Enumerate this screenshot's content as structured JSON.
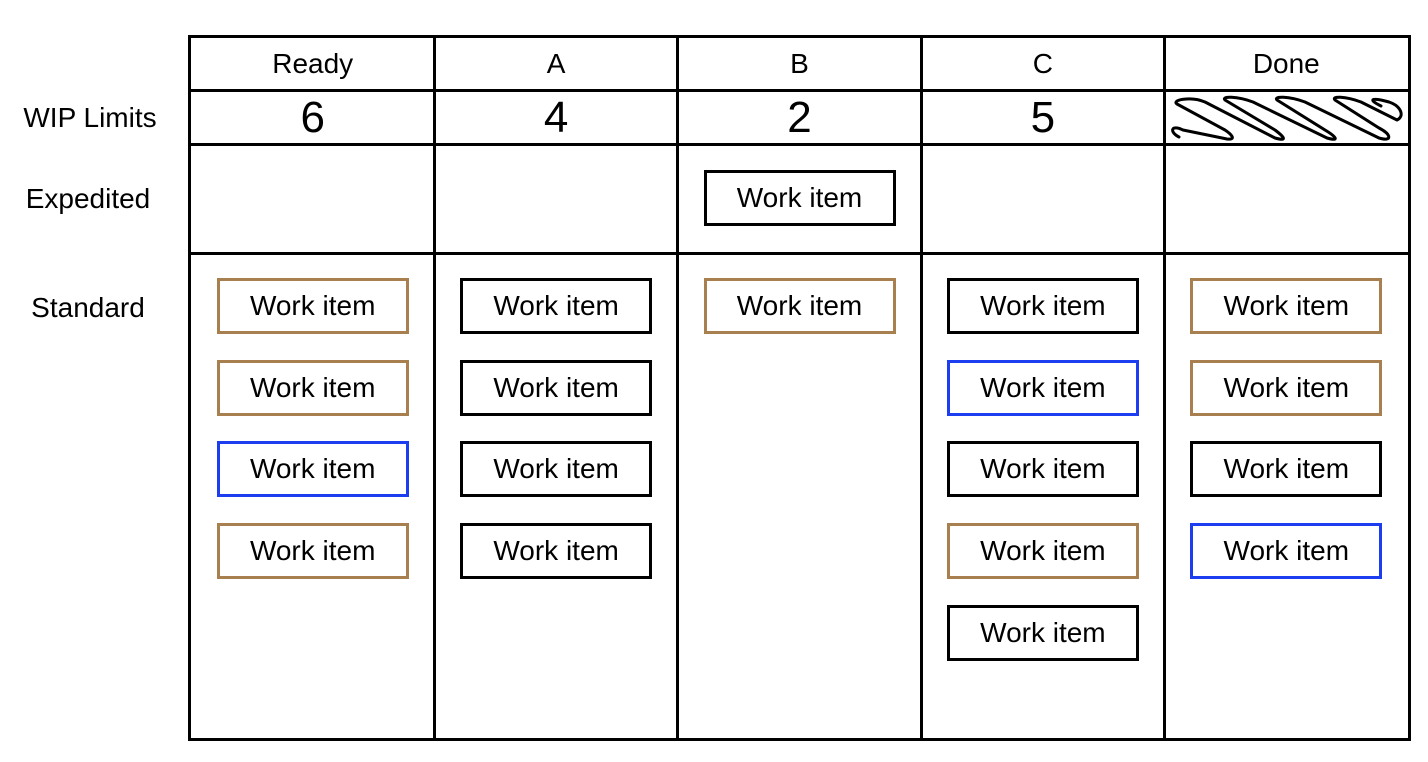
{
  "row_labels": {
    "wip": "WIP Limits",
    "expedited": "Expedited",
    "standard": "Standard"
  },
  "colors": {
    "default": "#000000",
    "brown": "#A8804F",
    "blue": "#1C3DF0"
  },
  "columns": [
    {
      "name": "Ready",
      "wip_limit": "6",
      "expedited": [],
      "standard": [
        {
          "label": "Work item",
          "color": "brown"
        },
        {
          "label": "Work item",
          "color": "brown"
        },
        {
          "label": "Work item",
          "color": "blue"
        },
        {
          "label": "Work item",
          "color": "brown"
        }
      ]
    },
    {
      "name": "A",
      "wip_limit": "4",
      "expedited": [],
      "standard": [
        {
          "label": "Work item",
          "color": "default"
        },
        {
          "label": "Work item",
          "color": "default"
        },
        {
          "label": "Work item",
          "color": "default"
        },
        {
          "label": "Work item",
          "color": "default"
        }
      ]
    },
    {
      "name": "B",
      "wip_limit": "2",
      "expedited": [
        {
          "label": "Work item",
          "color": "default"
        }
      ],
      "standard": [
        {
          "label": "Work item",
          "color": "brown"
        }
      ]
    },
    {
      "name": "C",
      "wip_limit": "5",
      "expedited": [],
      "standard": [
        {
          "label": "Work item",
          "color": "default"
        },
        {
          "label": "Work item",
          "color": "blue"
        },
        {
          "label": "Work item",
          "color": "default"
        },
        {
          "label": "Work item",
          "color": "brown"
        },
        {
          "label": "Work item",
          "color": "default"
        }
      ]
    },
    {
      "name": "Done",
      "wip_limit": null,
      "wip_hatched": true,
      "expedited": [],
      "standard": [
        {
          "label": "Work item",
          "color": "brown"
        },
        {
          "label": "Work item",
          "color": "brown"
        },
        {
          "label": "Work item",
          "color": "default"
        },
        {
          "label": "Work item",
          "color": "blue"
        }
      ]
    }
  ]
}
